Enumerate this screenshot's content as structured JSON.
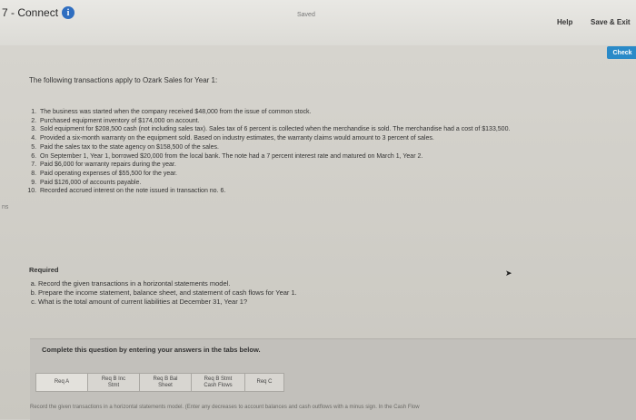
{
  "header": {
    "brand": "7 - Connect",
    "info_icon_glyph": "i",
    "saved_label": "Saved",
    "help_label": "Help",
    "save_exit_label": "Save & Exit",
    "check_label": "Check"
  },
  "problem": {
    "intro": "The following transactions apply to Ozark Sales for Year 1:",
    "transactions": [
      "The business was started when the company received $48,000 from the issue of common stock.",
      "Purchased equipment inventory of $174,000 on account.",
      "Sold equipment for $208,500 cash (not including sales tax). Sales tax of 6 percent is collected when the merchandise is sold. The merchandise had a cost of $133,500.",
      "Provided a six-month warranty on the equipment sold. Based on industry estimates, the warranty claims would amount to 3 percent of sales.",
      "Paid the sales tax to the state agency on $158,500 of the sales.",
      "On September 1, Year 1, borrowed $20,000 from the local bank. The note had a 7 percent interest rate and matured on March 1, Year 2.",
      "Paid $6,000 for warranty repairs during the year.",
      "Paid operating expenses of $55,500 for the year.",
      "Paid $126,000 of accounts payable.",
      "Recorded accrued interest on the note issued in transaction no. 6."
    ],
    "required_label": "Required",
    "requirements": [
      "Record the given transactions in a horizontal statements model.",
      "Prepare the income statement, balance sheet, and statement of cash flows for Year 1.",
      "What is the total amount of current liabilities at December 31, Year 1?"
    ]
  },
  "tabs_panel": {
    "instruction": "Complete this question by entering your answers in the tabs below.",
    "tabs": [
      {
        "label": "Req A"
      },
      {
        "label": "Req B Inc\nStmt"
      },
      {
        "label": "Req B Bal\nSheet"
      },
      {
        "label": "Req B Stmt\nCash Flows"
      },
      {
        "label": "Req C"
      }
    ],
    "hint": "Record the given transactions in a horizontal statements model. (Enter any decreases to account balances and cash outflows with a minus sign. In the Cash Flow"
  },
  "margin_marker": "ns"
}
